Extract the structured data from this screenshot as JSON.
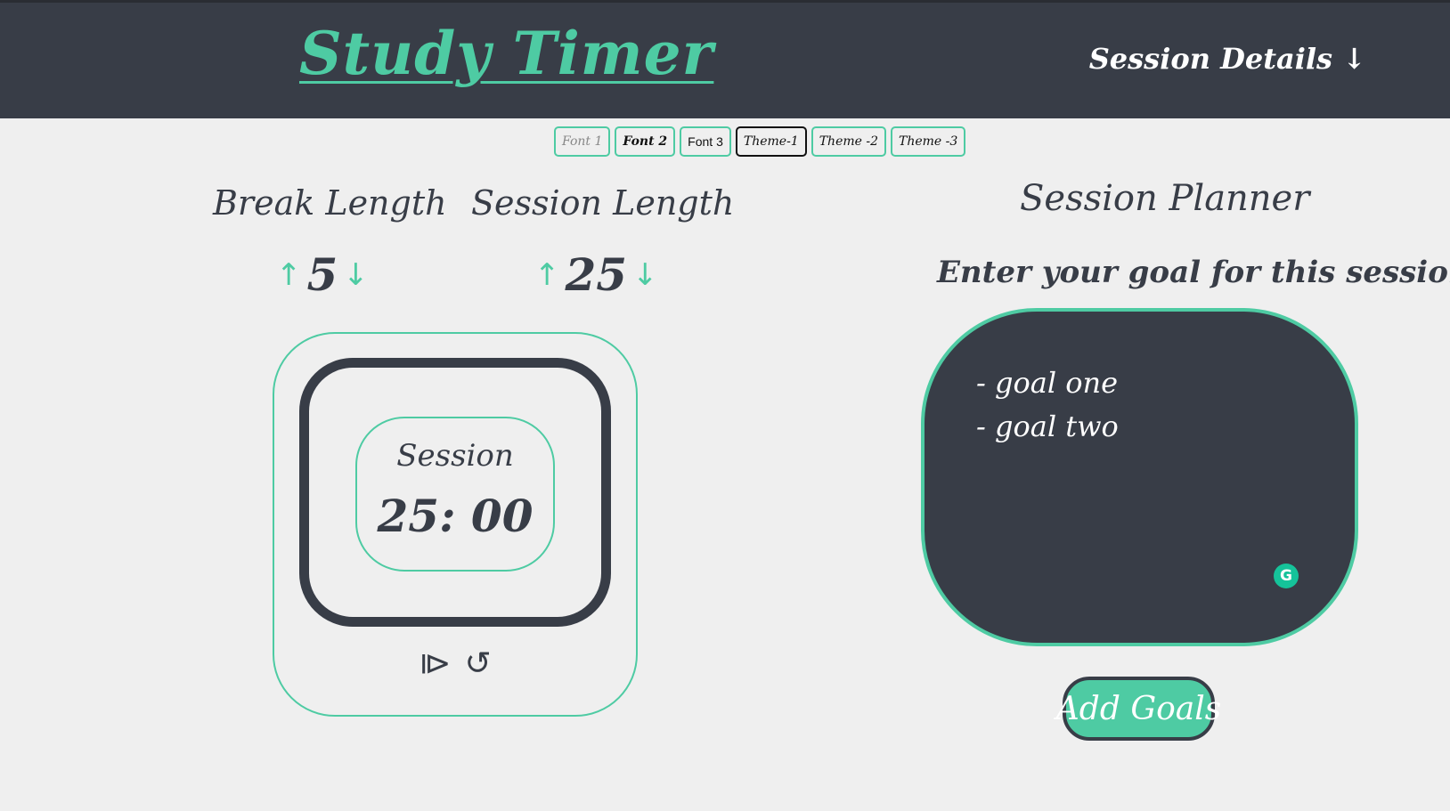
{
  "header": {
    "title": "Study Timer",
    "session_details": "Session Details ↓"
  },
  "switcher": {
    "buttons": [
      "Font 1",
      "Font 2",
      "Font 3",
      "Theme-1",
      "Theme -2",
      "Theme -3"
    ],
    "active": "Theme-1"
  },
  "break": {
    "label": "Break Length",
    "value": "5",
    "up_icon": "↑",
    "down_icon": "↓"
  },
  "session": {
    "label": "Session Length",
    "value": "25",
    "up_icon": "↑",
    "down_icon": "↓"
  },
  "timer": {
    "label": "Session",
    "value": "25: 00",
    "play_icon": "⧐",
    "reset_icon": "↺"
  },
  "planner": {
    "title": "Session Planner",
    "prompt": "Enter your goal for this session",
    "goals": [
      "- goal one",
      "- goal two"
    ],
    "add_button": "Add Goals",
    "grammarly_icon": "G"
  },
  "colors": {
    "accent": "#4ecba3",
    "dark": "#383d47",
    "background": "#efefef"
  }
}
